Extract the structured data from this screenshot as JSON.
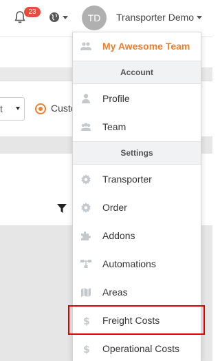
{
  "topbar": {
    "notification_count": "23",
    "avatar_initials": "TD",
    "user_name": "Transporter Demo"
  },
  "background": {
    "select_value": "t",
    "radio_label": "Custo"
  },
  "dropdown": {
    "team_name": "My Awesome Team",
    "account_header": "Account",
    "profile": "Profile",
    "team": "Team",
    "settings_header": "Settings",
    "transporter": "Transporter",
    "order": "Order",
    "addons": "Addons",
    "automations": "Automations",
    "areas": "Areas",
    "freight_costs": "Freight Costs",
    "operational_costs": "Operational Costs"
  },
  "colors": {
    "accent": "#ef7d2b",
    "badge": "#e74c3c",
    "highlight": "#e00000",
    "icon_gray": "#c4c9ce"
  }
}
